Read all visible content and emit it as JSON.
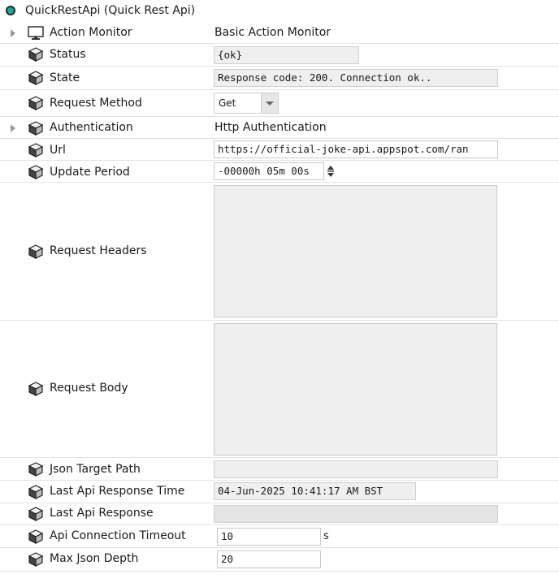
{
  "header": {
    "title": "QuickRestApi  (Quick Rest Api)"
  },
  "rows": [
    {
      "label": "Action Monitor",
      "value": "Basic Action Monitor"
    },
    {
      "label": "Status",
      "value": "{ok}"
    },
    {
      "label": "State",
      "value": "Response code: 200. Connection ok.."
    },
    {
      "label": "Request Method",
      "value": "Get"
    },
    {
      "label": "Authentication",
      "value": "Http Authentication"
    },
    {
      "label": "Url",
      "value": "https://official-joke-api.appspot.com/ran"
    },
    {
      "label": "Update Period",
      "value": "-00000h 05m 00s"
    },
    {
      "label": "Request Headers",
      "value": ""
    },
    {
      "label": "Request Body",
      "value": ""
    },
    {
      "label": "Json Target Path",
      "value": ""
    },
    {
      "label": "Last Api Response Time",
      "value": "04-Jun-2025 10:41:17 AM BST"
    },
    {
      "label": "Last Api Response",
      "value": ""
    },
    {
      "label": "Api Connection Timeout",
      "value": "10",
      "unit": "s"
    },
    {
      "label": "Max Json Depth",
      "value": "20"
    }
  ],
  "icons": {
    "title": "status-dot-icon",
    "action_monitor": "monitor-icon",
    "property": "cube-icon",
    "expander": "chevron-right-icon",
    "spinner": "spinner-icon"
  },
  "colors": {
    "status_dot": "#19a89a",
    "field_bg": "#efefef"
  }
}
